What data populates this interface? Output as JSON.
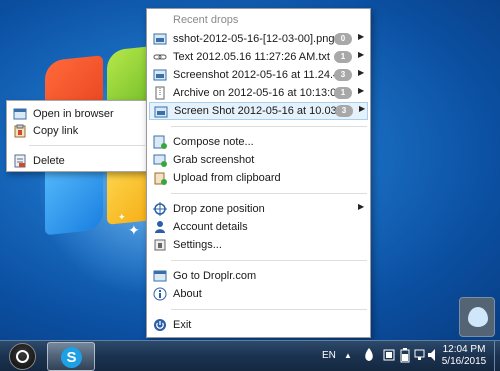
{
  "menu": {
    "header": "Recent drops",
    "recent_drops": [
      {
        "label": "sshot-2012-05-16-[12-03-00].png",
        "count": "0"
      },
      {
        "label": "Text 2012.05.16 11:27:26 AM.txt",
        "count": "1"
      },
      {
        "label": "Screenshot 2012-05-16 at 11.24.4...",
        "count": "3"
      },
      {
        "label": "Archive on 2012-05-16 at 10:13:0...",
        "count": "1"
      },
      {
        "label": "Screen Shot 2012-05-16 at 10.03....",
        "count": "3"
      }
    ],
    "actions": {
      "compose_note": "Compose note...",
      "grab_screenshot": "Grab screenshot",
      "upload_clipboard": "Upload from clipboard",
      "drop_zone": "Drop zone position",
      "account_details": "Account details",
      "settings": "Settings...",
      "go_to_droplr": "Go to Droplr.com",
      "about": "About",
      "exit": "Exit"
    }
  },
  "submenu": {
    "open_in_browser": "Open in browser",
    "copy_link": "Copy link",
    "delete": "Delete"
  },
  "taskbar": {
    "language": "EN",
    "time": "12:04 PM",
    "date": "5/16/2015"
  },
  "colors": {
    "highlight_bg": "#e5f1fb",
    "highlight_border": "#a8cfee",
    "badge": "#a8a8a8",
    "header_text": "#8a8a8a"
  }
}
